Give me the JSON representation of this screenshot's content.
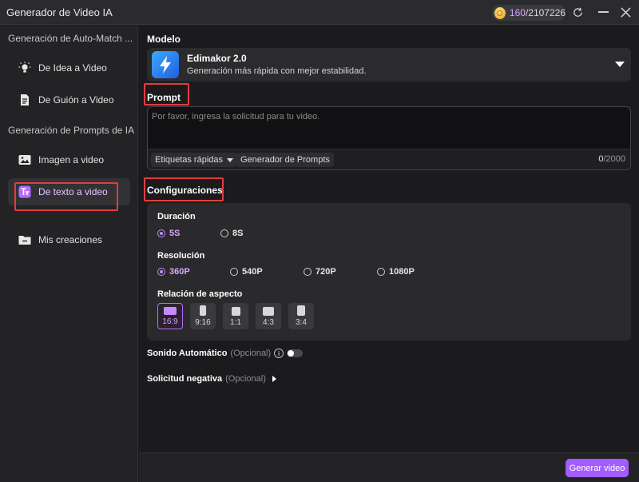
{
  "window": {
    "title": "Generador de Video IA",
    "credits": {
      "used": "160",
      "separator": "/",
      "total": "2107226"
    }
  },
  "sidebar": {
    "group1": "Generación de Auto-Match ...",
    "group2": "Generación de Prompts de IA",
    "items": [
      {
        "label": "De Idea a Video",
        "icon": "bulb-icon"
      },
      {
        "label": "De Guión a Video",
        "icon": "document-icon"
      },
      {
        "label": "Imagen a video",
        "icon": "image-icon"
      },
      {
        "label": "De texto a video",
        "icon": "text-icon",
        "active": true
      },
      {
        "label": "Mis creaciones",
        "icon": "folder-icon"
      }
    ]
  },
  "model": {
    "section": "Modelo",
    "name": "Edimakor 2.0",
    "description": "Generación más rápida con mejor estabilidad."
  },
  "prompt": {
    "section": "Prompt",
    "placeholder": "Por favor, ingresa la solicitud para tu video.",
    "quick_tags": "Etiquetas rápidas",
    "generator": "Generador de Prompts",
    "count": "0",
    "max": "/2000"
  },
  "config": {
    "section": "Configuraciones",
    "duration": {
      "label": "Duración",
      "options": [
        "5S",
        "8S"
      ],
      "selected": "5S"
    },
    "resolution": {
      "label": "Resolución",
      "options": [
        "360P",
        "540P",
        "720P",
        "1080P"
      ],
      "selected": "360P"
    },
    "aspect": {
      "label": "Relación de aspecto",
      "options": [
        "16:9",
        "9:16",
        "1:1",
        "4:3",
        "3:4"
      ],
      "selected": "16:9"
    }
  },
  "options": {
    "sound_label": "Sonido Automático",
    "sound_optional": "(Opcional)",
    "sound_enabled": false,
    "negative_label": "Solicitud negativa",
    "negative_optional": "(Opcional)"
  },
  "actions": {
    "generate": "Generar video"
  },
  "colors": {
    "accent": "#a35cff",
    "annotation": "#e23c3c"
  }
}
